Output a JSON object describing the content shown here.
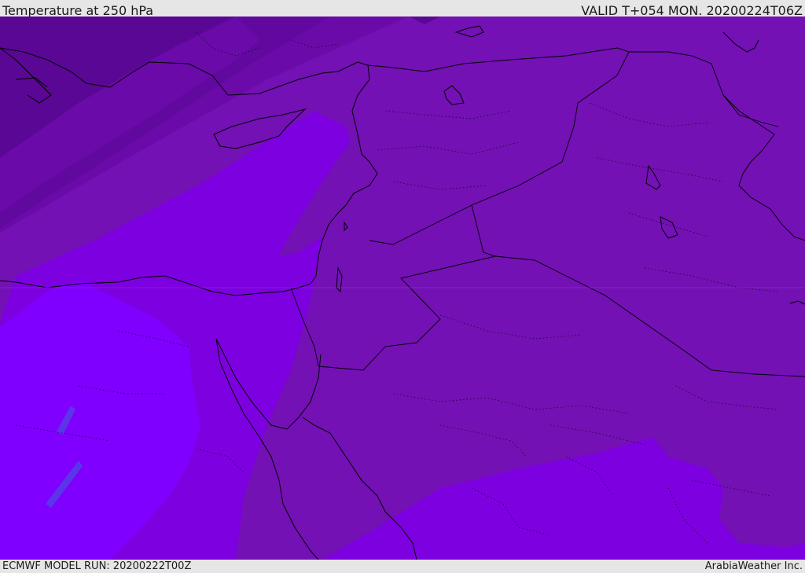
{
  "header": {
    "title": "Temperature at 250 hPa",
    "valid_time": "VALID T+054 MON. 20200224T06Z"
  },
  "footer": {
    "model_run": "ECMWF MODEL RUN: 20200222T00Z",
    "credit": "ArabiaWeather Inc."
  },
  "map": {
    "fill_colors": {
      "darkest": "#5a0796",
      "dark": "#6a0aa8",
      "base": "#7311b4",
      "medium": "#7d00e0",
      "light": "#7f00ff",
      "blue_patch": "#5a36e8"
    },
    "border_color": "#000000"
  }
}
